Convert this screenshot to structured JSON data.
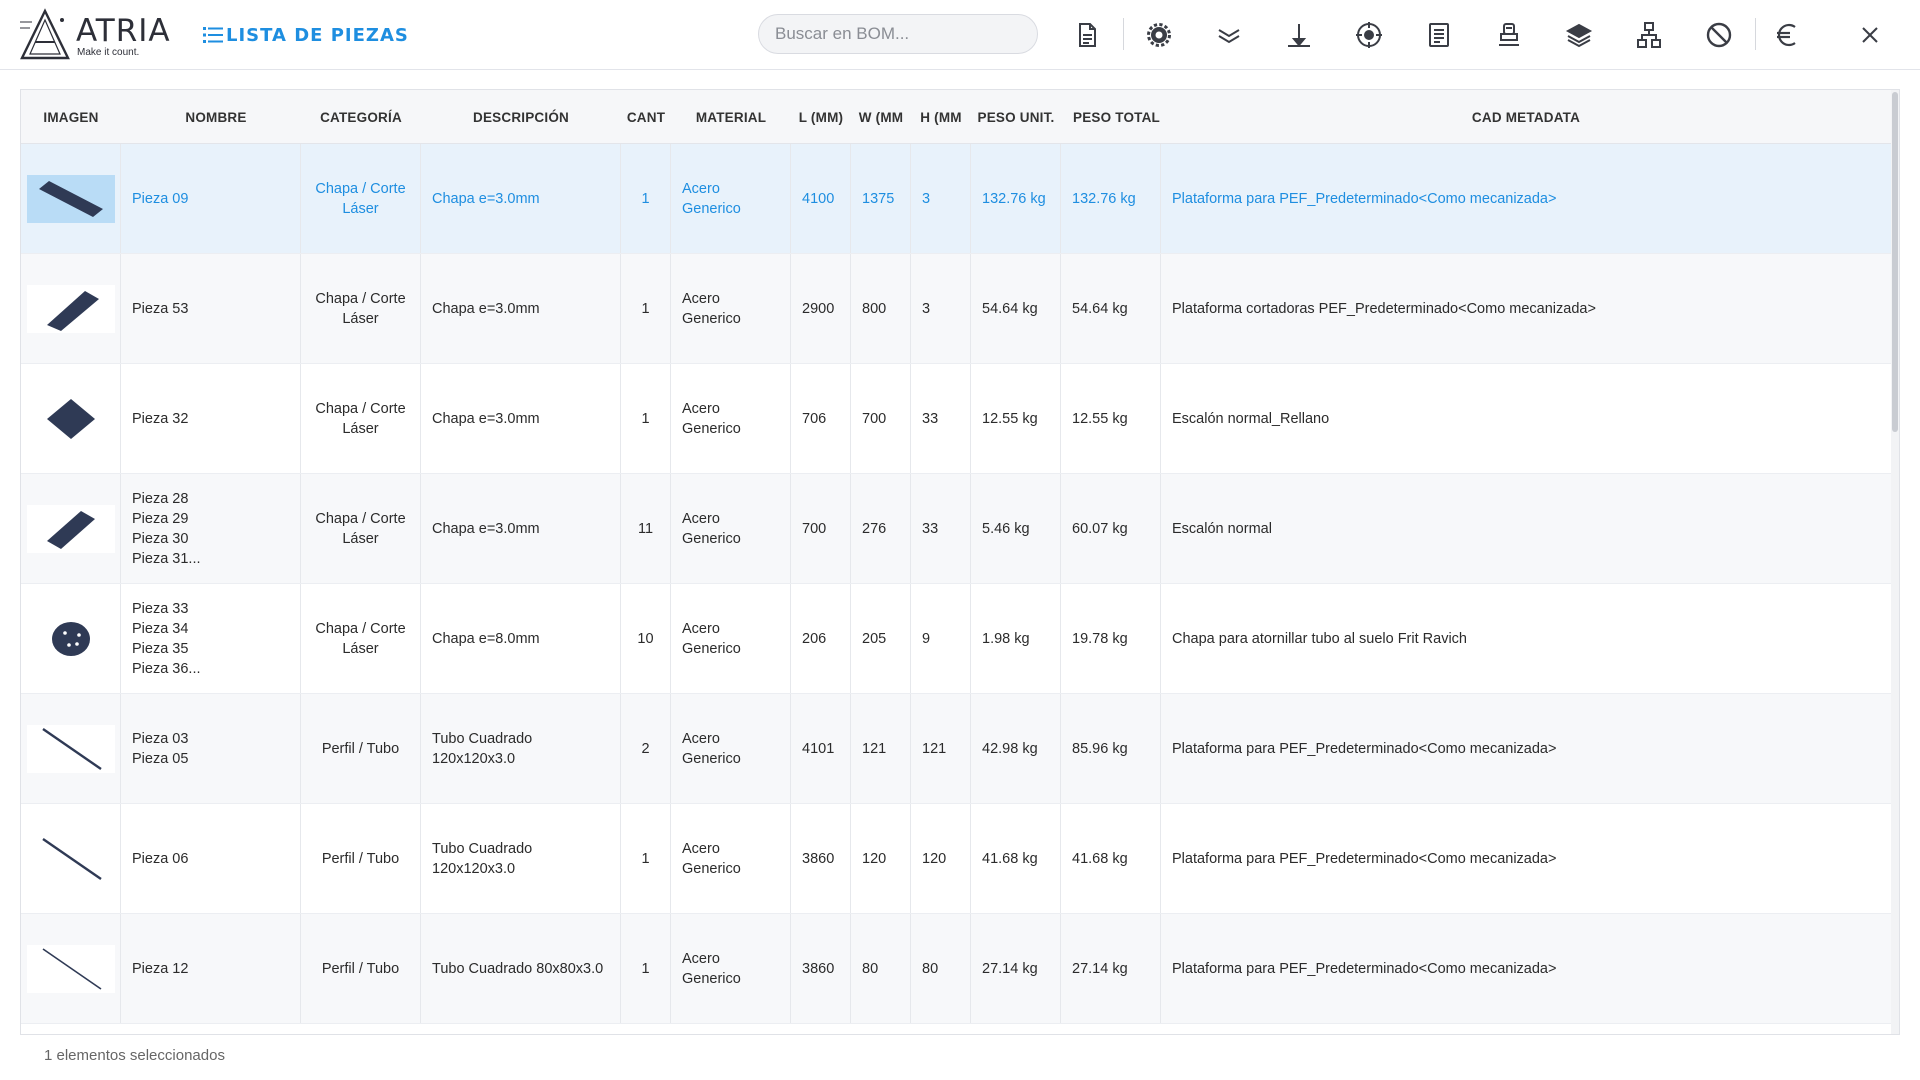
{
  "brand": {
    "name": "ATRIA",
    "tagline": "Make it count."
  },
  "header": {
    "title": "LISTA DE PIEZAS"
  },
  "search": {
    "placeholder": "Buscar en BOM..."
  },
  "toolbar": {
    "icons": [
      "document-icon",
      "gear-cog-icon",
      "chevrons-down-icon",
      "weld-icon",
      "target-icon",
      "report-icon",
      "stamp-icon",
      "layers-icon",
      "hierarchy-icon",
      "block-icon",
      "euro-icon",
      "close-icon"
    ]
  },
  "table": {
    "columns": [
      "IMAGEN",
      "NOMBRE",
      "CATEGORÍA",
      "DESCRIPCIÓN",
      "CANT",
      "MATERIAL",
      "L (MM)",
      "W (MM",
      "H (MM",
      "PESO UNIT.",
      "PESO TOTAL",
      "CAD METADATA"
    ],
    "rows": [
      {
        "shape": "plate-diag",
        "name": [
          "Pieza 09"
        ],
        "category": "Chapa / Corte Láser",
        "description": "Chapa e=3.0mm",
        "qty": "1",
        "material": "Acero Generico",
        "l": "4100",
        "w": "1375",
        "h": "3",
        "unit_weight": "132.76 kg",
        "total_weight": "132.76 kg",
        "metadata": "Plataforma para PEF_Predeterminado<Como mecanizada>"
      },
      {
        "shape": "plate-wide",
        "name": [
          "Pieza 53"
        ],
        "category": "Chapa / Corte Láser",
        "description": "Chapa e=3.0mm",
        "qty": "1",
        "material": "Acero Generico",
        "l": "2900",
        "w": "800",
        "h": "3",
        "unit_weight": "54.64 kg",
        "total_weight": "54.64 kg",
        "metadata": "Plataforma cortadoras PEF_Predeterminado<Como mecanizada>"
      },
      {
        "shape": "diamond",
        "name": [
          "Pieza 32"
        ],
        "category": "Chapa / Corte Láser",
        "description": "Chapa e=3.0mm",
        "qty": "1",
        "material": "Acero Generico",
        "l": "706",
        "w": "700",
        "h": "33",
        "unit_weight": "12.55 kg",
        "total_weight": "12.55 kg",
        "metadata": "Escalón normal_Rellano"
      },
      {
        "shape": "plate-narrow",
        "name": [
          "Pieza 28",
          "Pieza 29",
          "Pieza 30",
          "Pieza 31..."
        ],
        "category": "Chapa / Corte Láser",
        "description": "Chapa e=3.0mm",
        "qty": "11",
        "material": "Acero Generico",
        "l": "700",
        "w": "276",
        "h": "33",
        "unit_weight": "5.46 kg",
        "total_weight": "60.07 kg",
        "metadata": "Escalón normal"
      },
      {
        "shape": "disc",
        "name": [
          "Pieza 33",
          "Pieza 34",
          "Pieza 35",
          "Pieza 36..."
        ],
        "category": "Chapa / Corte Láser",
        "description": "Chapa e=8.0mm",
        "qty": "10",
        "material": "Acero Generico",
        "l": "206",
        "w": "205",
        "h": "9",
        "unit_weight": "1.98 kg",
        "total_weight": "19.78 kg",
        "metadata": "Chapa para atornillar tubo al suelo Frit Ravich"
      },
      {
        "shape": "line",
        "name": [
          "Pieza 03",
          "Pieza 05"
        ],
        "category": "Perfil / Tubo",
        "description": "Tubo Cuadrado 120x120x3.0",
        "qty": "2",
        "material": "Acero Generico",
        "l": "4101",
        "w": "121",
        "h": "121",
        "unit_weight": "42.98 kg",
        "total_weight": "85.96 kg",
        "metadata": "Plataforma para PEF_Predeterminado<Como mecanizada>"
      },
      {
        "shape": "line",
        "name": [
          "Pieza 06"
        ],
        "category": "Perfil / Tubo",
        "description": "Tubo Cuadrado 120x120x3.0",
        "qty": "1",
        "material": "Acero Generico",
        "l": "3860",
        "w": "120",
        "h": "120",
        "unit_weight": "41.68 kg",
        "total_weight": "41.68 kg",
        "metadata": "Plataforma para PEF_Predeterminado<Como mecanizada>"
      },
      {
        "shape": "line-thin",
        "name": [
          "Pieza 12"
        ],
        "category": "Perfil / Tubo",
        "description": "Tubo Cuadrado 80x80x3.0",
        "qty": "1",
        "material": "Acero Generico",
        "l": "3860",
        "w": "80",
        "h": "80",
        "unit_weight": "27.14 kg",
        "total_weight": "27.14 kg",
        "metadata": "Plataforma para PEF_Predeterminado<Como mecanizada>"
      }
    ],
    "selected_row": 0
  },
  "status": {
    "text": "1 elementos seleccionados"
  },
  "colors": {
    "accent": "#1e8ee0",
    "selected_row": "#e8f2fb",
    "part": "#2f3a55"
  }
}
